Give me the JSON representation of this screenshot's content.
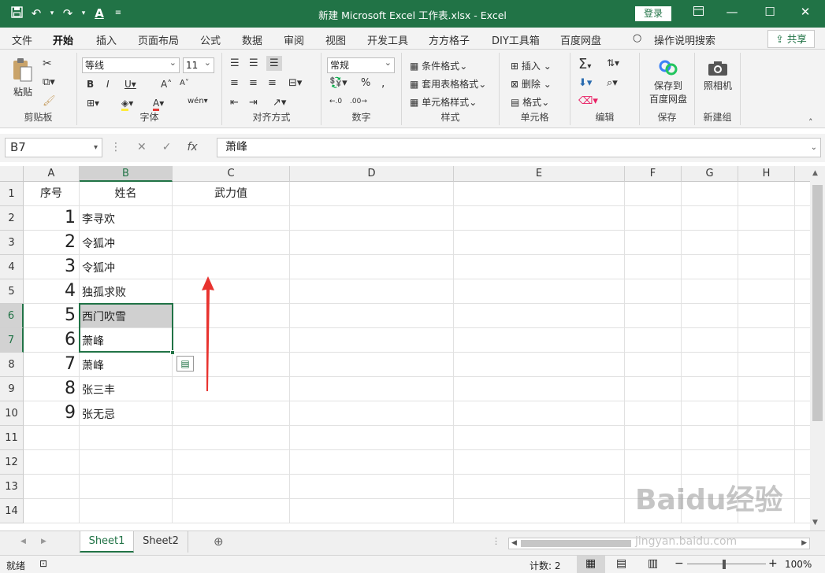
{
  "titlebar": {
    "title": "新建 Microsoft Excel 工作表.xlsx  -  Excel",
    "login": "登录",
    "qat": [
      "save-icon",
      "undo-icon",
      "redo-icon",
      "font-color-icon",
      "customize-icon"
    ]
  },
  "menu": {
    "tabs": [
      "文件",
      "开始",
      "插入",
      "页面布局",
      "公式",
      "数据",
      "审阅",
      "视图",
      "开发工具",
      "方方格子",
      "DIY工具箱",
      "百度网盘"
    ],
    "search": "操作说明搜索",
    "share": "共享"
  },
  "ribbon": {
    "clipboard": {
      "paste": "粘贴",
      "label": "剪贴板"
    },
    "font": {
      "name": "等线",
      "size": "11",
      "label": "字体"
    },
    "alignment": {
      "label": "对齐方式"
    },
    "number": {
      "format": "常规",
      "label": "数字"
    },
    "styles": {
      "conditional": "条件格式",
      "table": "套用表格格式",
      "cell": "单元格样式",
      "label": "样式"
    },
    "cells": {
      "insert": "插入",
      "delete": "删除",
      "format": "格式",
      "label": "单元格"
    },
    "editing": {
      "label": "编辑"
    },
    "save": {
      "button": "保存到\n百度网盘",
      "line1": "保存到",
      "line2": "百度网盘",
      "label": "保存"
    },
    "newgroup": {
      "camera": "照相机",
      "label": "新建组"
    }
  },
  "formula": {
    "namebox": "B7",
    "value": "萧峰",
    "fx": "fx"
  },
  "grid": {
    "columns": [
      "A",
      "B",
      "C",
      "D",
      "E",
      "F",
      "G",
      "H"
    ],
    "rows": [
      "1",
      "2",
      "3",
      "4",
      "5",
      "6",
      "7",
      "8",
      "9",
      "10",
      "11",
      "12",
      "13",
      "14"
    ],
    "header": [
      "序号",
      "姓名",
      "武力值"
    ],
    "data": [
      {
        "no": "1",
        "name": "李寻欢"
      },
      {
        "no": "2",
        "name": "令狐冲"
      },
      {
        "no": "3",
        "name": "令狐冲"
      },
      {
        "no": "4",
        "name": "独孤求败"
      },
      {
        "no": "5",
        "name": "西门吹雪"
      },
      {
        "no": "6",
        "name": "萧峰"
      },
      {
        "no": "7",
        "name": "萧峰"
      },
      {
        "no": "8",
        "name": "张三丰"
      },
      {
        "no": "9",
        "name": "张无忌"
      }
    ]
  },
  "sheets": [
    "Sheet1",
    "Sheet2"
  ],
  "status": {
    "ready": "就绪",
    "count": "计数: 2",
    "zoom": "100%"
  },
  "watermark": {
    "line1": "Baidu经验",
    "line2": "jingyan.baidu.com"
  },
  "colors": {
    "accent": "#217346",
    "arrow": "#e8332f"
  }
}
